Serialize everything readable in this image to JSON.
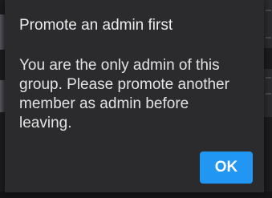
{
  "dialog": {
    "title": "Promote an admin first",
    "message": "You are the only admin of this group. Please promote another member as admin before leaving.",
    "ok_label": "OK"
  },
  "colors": {
    "dialog_background": "#2b2b2d",
    "accent": "#2196f3",
    "text": "#ececec"
  }
}
